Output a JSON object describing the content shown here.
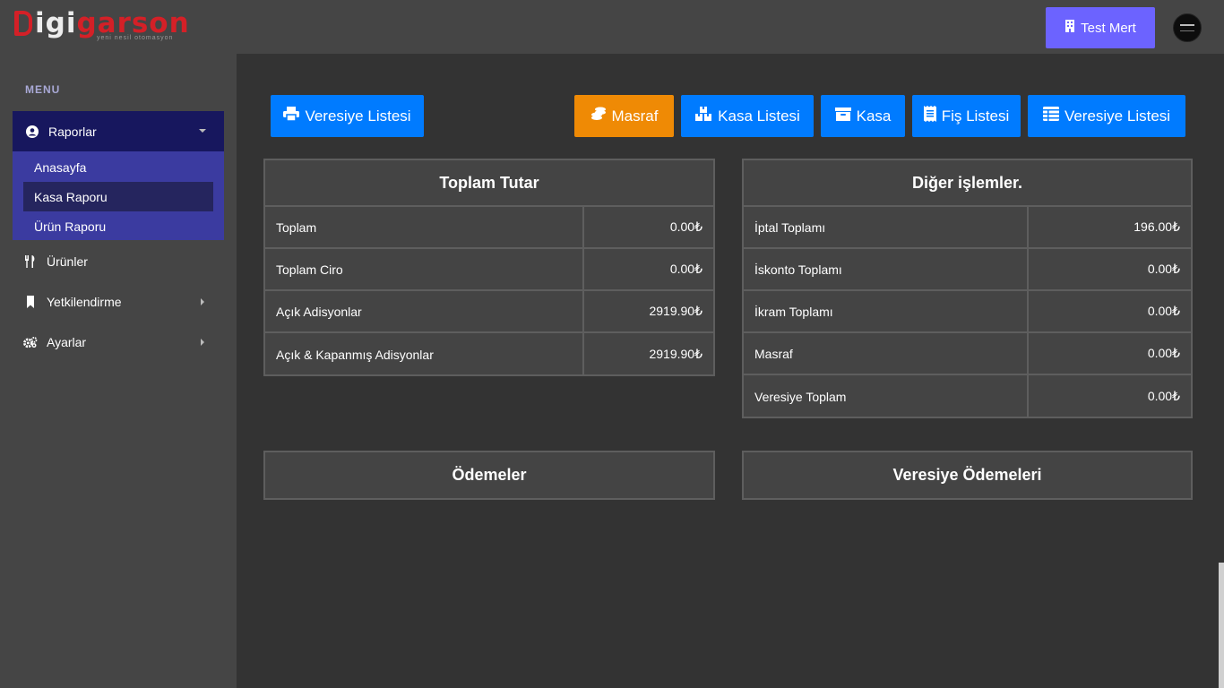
{
  "brand": {
    "logo_white": "igi",
    "logo_red": "garson",
    "tagline": "yeni nesil otomasyon",
    "colors": {
      "red": "#d42027",
      "accent": "#6c63ff",
      "blue": "#007bff",
      "orange": "#ef8a05"
    }
  },
  "header": {
    "user_label": "Test Mert",
    "user_icon": "building-icon",
    "avatar_icon": "avatar-icon"
  },
  "sidebar": {
    "menu_label": "MENU",
    "group": {
      "label": "Raporlar",
      "icon": "user-circle-icon",
      "items": [
        {
          "label": "Anasayfa",
          "active": false
        },
        {
          "label": "Kasa Raporu",
          "active": true
        },
        {
          "label": "Ürün Raporu",
          "active": false
        }
      ]
    },
    "items": [
      {
        "label": "Ürünler",
        "icon": "utensils-icon",
        "has_arrow": false
      },
      {
        "label": "Yetkilendirme",
        "icon": "bookmark-icon",
        "has_arrow": true
      },
      {
        "label": "Ayarlar",
        "icon": "gears-icon",
        "has_arrow": true
      }
    ]
  },
  "toolbar": {
    "print_veresiye": "Veresiye Listesi",
    "masraf": "Masraf",
    "kasa_listesi": "Kasa Listesi",
    "kasa": "Kasa",
    "fis_listesi": "Fiş Listesi",
    "veresiye_listesi": "Veresiye Listesi"
  },
  "toplam": {
    "title": "Toplam Tutar",
    "rows": [
      {
        "label": "Toplam",
        "value": "0.00₺"
      },
      {
        "label": "Toplam Ciro",
        "value": "0.00₺"
      },
      {
        "label": "Açık Adisyonlar",
        "value": "2919.90₺"
      },
      {
        "label": "Açık & Kapanmış Adisyonlar",
        "value": "2919.90₺"
      }
    ]
  },
  "diger": {
    "title": "Diğer işlemler.",
    "rows": [
      {
        "label": "İptal Toplamı",
        "value": "196.00₺"
      },
      {
        "label": "İskonto Toplamı",
        "value": "0.00₺"
      },
      {
        "label": "İkram Toplamı",
        "value": "0.00₺"
      },
      {
        "label": "Masraf",
        "value": "0.00₺"
      },
      {
        "label": "Veresiye Toplam",
        "value": "0.00₺"
      }
    ]
  },
  "odemeler": {
    "title": "Ödemeler"
  },
  "veresiye_odemeleri": {
    "title": "Veresiye Ödemeleri"
  }
}
